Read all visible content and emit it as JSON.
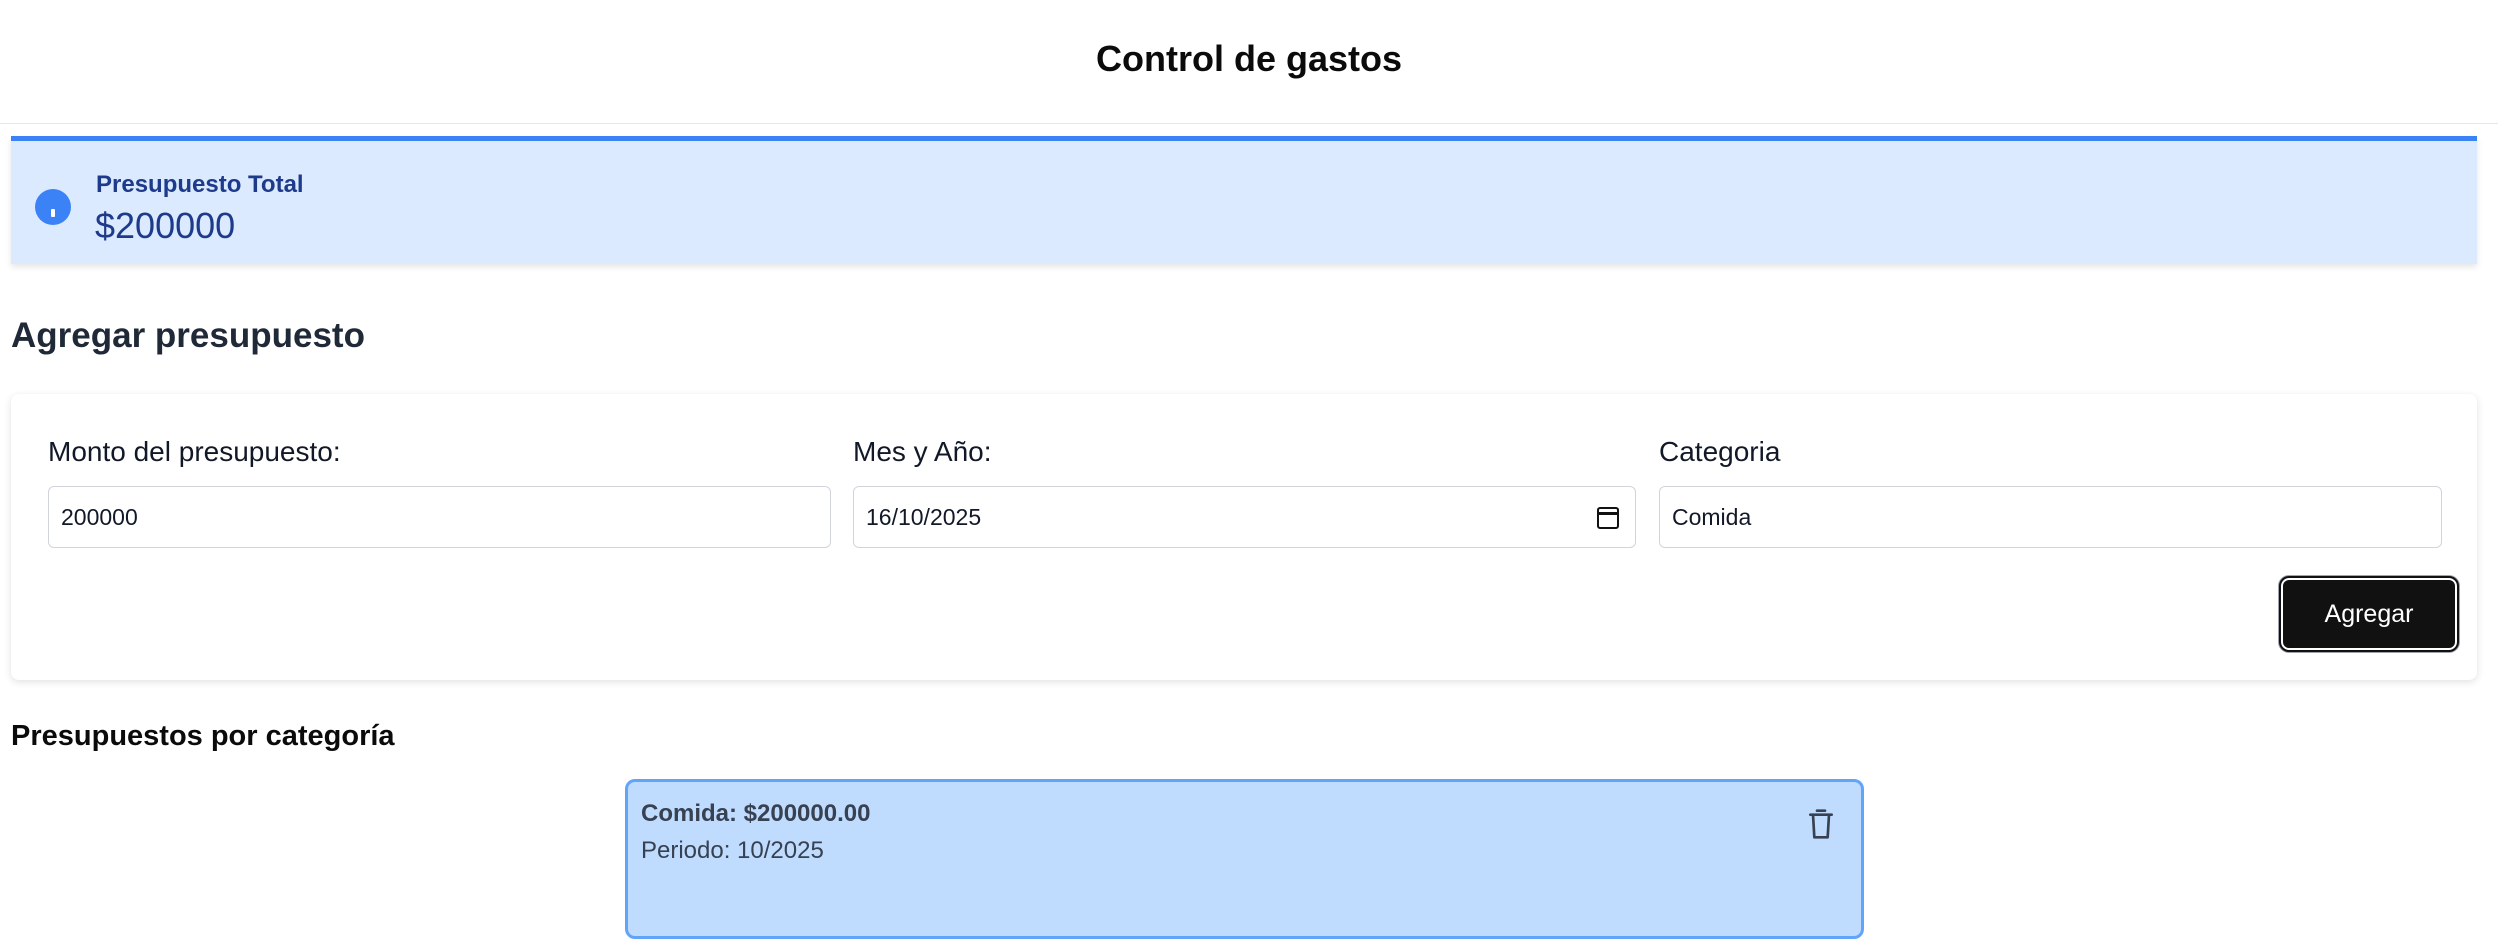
{
  "header": {
    "title": "Control de gastos"
  },
  "total": {
    "label": "Presupuesto Total",
    "value": "$200000",
    "icon": "info-icon"
  },
  "form": {
    "title": "Agregar presupuesto",
    "amount": {
      "label": "Monto del presupuesto:",
      "value": "200000"
    },
    "date": {
      "label": "Mes y Año:",
      "value": "16/10/2025",
      "icon": "calendar-icon"
    },
    "category": {
      "label": "Categoria",
      "value": "Comida"
    },
    "submit_label": "Agregar"
  },
  "list": {
    "title": "Presupuestos por categoría",
    "items": [
      {
        "title": "Comida: $200000.00",
        "period": "Periodo: 10/2025",
        "icon": "trash-icon"
      }
    ]
  },
  "colors": {
    "accent": "#3b82f6",
    "banner_bg": "#dbeafe",
    "card_bg": "#bfdbfe",
    "button_bg": "#111111"
  }
}
